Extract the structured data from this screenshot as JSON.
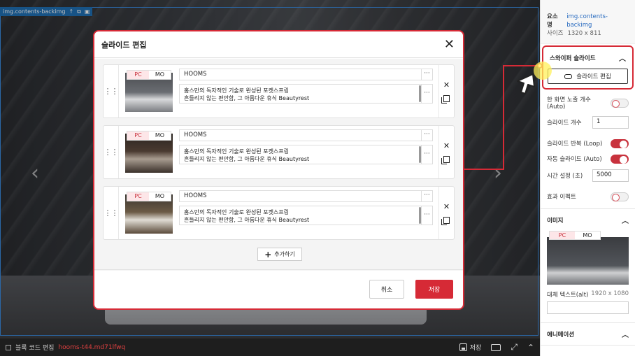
{
  "canvas": {
    "tag": "img.contents-backimg",
    "tag_icons": [
      "arrow-up-icon",
      "copy-icon",
      "delete-icon"
    ]
  },
  "bottombar": {
    "code_label": "블록 코드 편집",
    "code_id": "hooms-t44.md71lfwq",
    "save_label": "저장"
  },
  "panel": {
    "element_label": "요소명",
    "element_value": "img.contents-backimg",
    "size_label": "사이즈",
    "size_value": "1320 x 811",
    "swiper_title": "스와이퍼 슬라이드",
    "edit_slide_label": "슬라이드 편집",
    "rows": {
      "visible_count": "한 화면 노출 개수 (Auto)",
      "slide_count": "슬라이드 개수",
      "slide_count_value": "1",
      "loop": "슬라이드 반복 (Loop)",
      "auto": "자동 슬라이드 (Auto)",
      "time": "시간 설정 (초)",
      "time_value": "5000",
      "effect": "효과 이펙트"
    },
    "image_title": "이미지",
    "tab_pc": "PC",
    "tab_mo": "MO",
    "alt_label": "대체 텍스트(alt)",
    "alt_size": "1920 x 1080",
    "animation_title": "애니메이션"
  },
  "modal": {
    "title": "슬라이드 편집",
    "tab_pc": "PC",
    "tab_mo": "MO",
    "slides": [
      {
        "title": "HOOMS",
        "desc_line1": "홈스만의 독자적인 기술로 완성된 포켓스프링",
        "desc_line2": "흔들리지 않는 편안함, 그 아름다운 휴식 Beautyrest"
      },
      {
        "title": "HOOMS",
        "desc_line1": "홈스만의 독자적인 기술로 완성된 포켓스프링",
        "desc_line2": "흔들리지 않는 편안함, 그 아름다운 휴식 Beautyrest"
      },
      {
        "title": "HOOMS",
        "desc_line1": "홈스만의 독자적인 기술로 완성된 포켓스프링",
        "desc_line2": "흔들리지 않는 편안함, 그 아름다운 휴식 Beautyrest"
      }
    ],
    "more": "···",
    "add_label": "추가하기",
    "cancel_label": "취소",
    "save_label": "저장"
  },
  "colors": {
    "accent": "#d62a36",
    "link": "#2a6cc0",
    "canvas_outline": "#3a8be0"
  }
}
